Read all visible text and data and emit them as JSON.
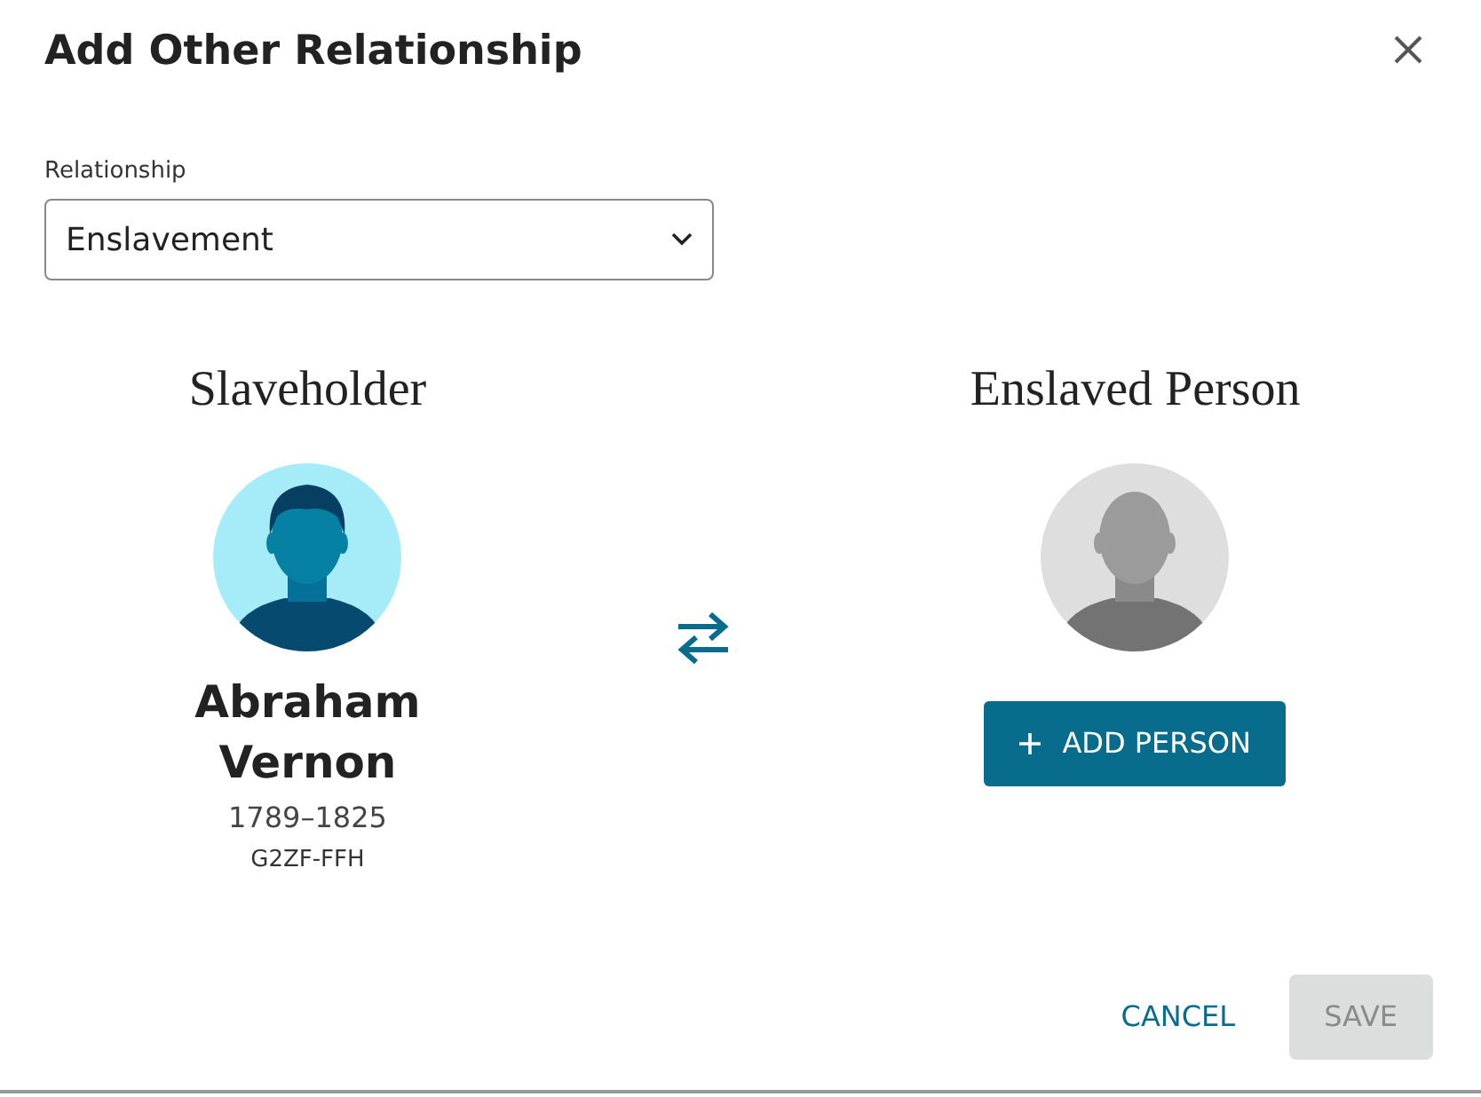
{
  "dialog": {
    "title": "Add Other Relationship"
  },
  "relationship": {
    "label": "Relationship",
    "value": "Enslavement"
  },
  "sides": [
    {
      "kind": "person",
      "heading": "Slaveholder",
      "name": "Abraham Vernon",
      "lifespan": "1789–1825",
      "id": "G2ZF-FFH"
    },
    {
      "kind": "empty",
      "heading": "Enslaved Person",
      "button": "ADD PERSON"
    }
  ],
  "buttons": [
    {
      "label": "CANCEL",
      "kind": "text",
      "disabled": false
    },
    {
      "label": "SAVE",
      "kind": "filled",
      "disabled": true
    }
  ]
}
